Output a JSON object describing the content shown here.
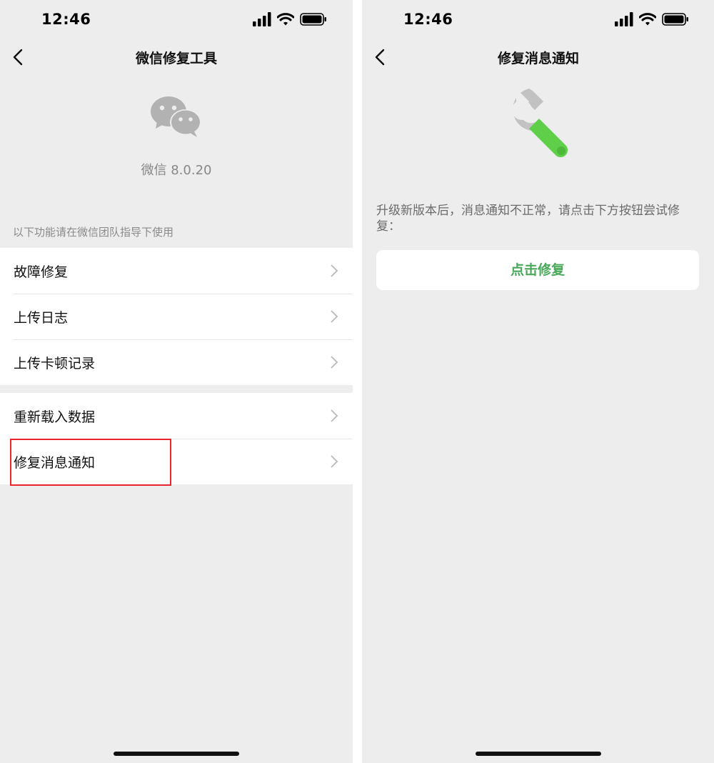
{
  "status_bar": {
    "time": "12:46",
    "icons": [
      "signal-icon",
      "wifi-icon",
      "battery-icon"
    ]
  },
  "left_screen": {
    "nav": {
      "title": "微信修复工具",
      "back_icon": "chevron-left-icon"
    },
    "app": {
      "logo_icon": "wechat-logo-icon",
      "version": "微信 8.0.20"
    },
    "section_hint": "以下功能请在微信团队指导下使用",
    "groups": [
      {
        "items": [
          {
            "label": "故障修复"
          },
          {
            "label": "上传日志"
          },
          {
            "label": "上传卡顿记录"
          }
        ]
      },
      {
        "items": [
          {
            "label": "重新载入数据"
          },
          {
            "label": "修复消息通知"
          }
        ]
      }
    ],
    "highlighted_item": "修复消息通知",
    "highlight_color": "#e8262c"
  },
  "right_screen": {
    "nav": {
      "title": "修复消息通知",
      "back_icon": "chevron-left-icon"
    },
    "illustration_icon": "wrench-icon",
    "description": "升级新版本后，消息通知不正常，请点击下方按钮尝试修复：",
    "button_label": "点击修复",
    "accent_color": "#4aa85a"
  },
  "colors": {
    "background": "#ededed",
    "card": "#ffffff",
    "wrench_green": "#5fcf4a",
    "wrench_gray": "#bdbdbd"
  }
}
